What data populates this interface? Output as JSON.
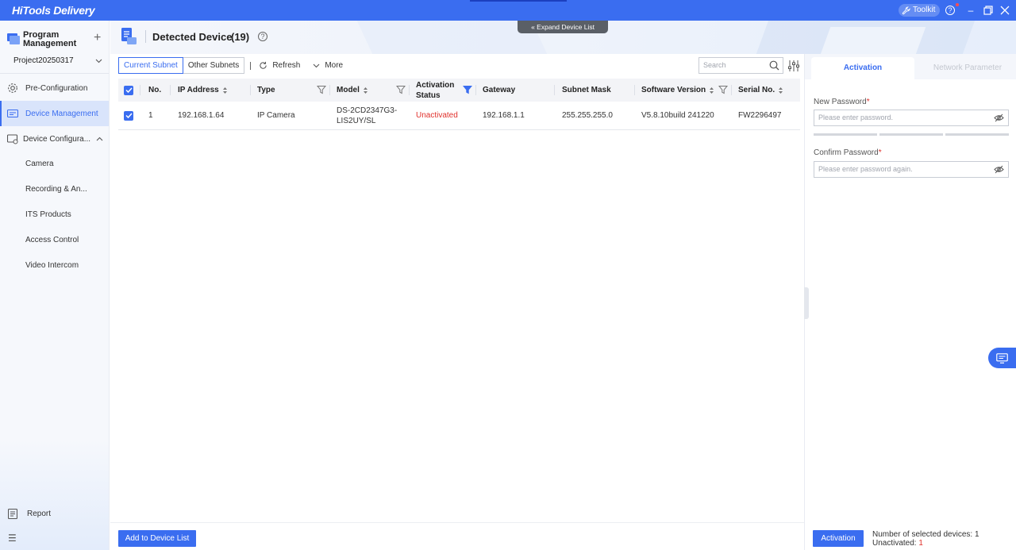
{
  "app": {
    "title": "HiTools Delivery",
    "toolkit_label": "Toolkit",
    "help_glyph": "?",
    "minimize_glyph": "–",
    "restore_glyph": "❒",
    "close_glyph": "✕"
  },
  "sidebar": {
    "program_title": "Program Management",
    "add_glyph": "+",
    "project": "Project20250317",
    "items": [
      {
        "label": "Pre-Configuration",
        "icon": "gear-icon"
      },
      {
        "label": "Device Management",
        "icon": "device-icon",
        "active": true
      },
      {
        "label": "Device Configura...",
        "icon": "device-config-icon"
      }
    ],
    "subitems": [
      "Camera",
      "Recording & An...",
      "ITS Products",
      "Access Control",
      "Video Intercom"
    ],
    "report_label": "Report",
    "menu_glyph": "☰"
  },
  "header": {
    "title": "Detected Device",
    "count": "(19)",
    "help_glyph": "?",
    "expand_label": "Expand Device List"
  },
  "toolbar": {
    "tab_current": "Current Subnet",
    "tab_other": "Other Subnets",
    "refresh_label": "Refresh",
    "more_label": "More",
    "search_placeholder": "Search"
  },
  "table": {
    "headers": {
      "no": "No.",
      "ip": "IP Address",
      "type": "Type",
      "model": "Model",
      "activation_line1": "Activation",
      "activation_line2": "Status",
      "gateway": "Gateway",
      "subnet": "Subnet Mask",
      "software": "Software Version",
      "serial": "Serial No."
    },
    "rows": [
      {
        "no": "1",
        "ip": "192.168.1.64",
        "type": "IP Camera",
        "model_line1": "DS-2CD2347G3-",
        "model_line2": "LIS2UY/SL",
        "status": "Unactivated",
        "gateway": "192.168.1.1",
        "subnet": "255.255.255.0",
        "software": "V5.8.10build 241220",
        "serial": "FW2296497"
      }
    ]
  },
  "bottom": {
    "add_button": "Add to Device List",
    "activation_button": "Activation",
    "selected_label": "Number of selected devices: 1",
    "unactivated_label": "Unactivated:",
    "unactivated_count": "1"
  },
  "panel": {
    "tab_activation": "Activation",
    "tab_network": "Network Parameter",
    "new_password_label": "New Password",
    "new_password_placeholder": "Please enter password.",
    "confirm_label": "Confirm Password",
    "confirm_placeholder": "Please enter password again.",
    "required_mark": "*"
  },
  "colors": {
    "accent": "#3a6df0",
    "danger": "#e0302b"
  }
}
